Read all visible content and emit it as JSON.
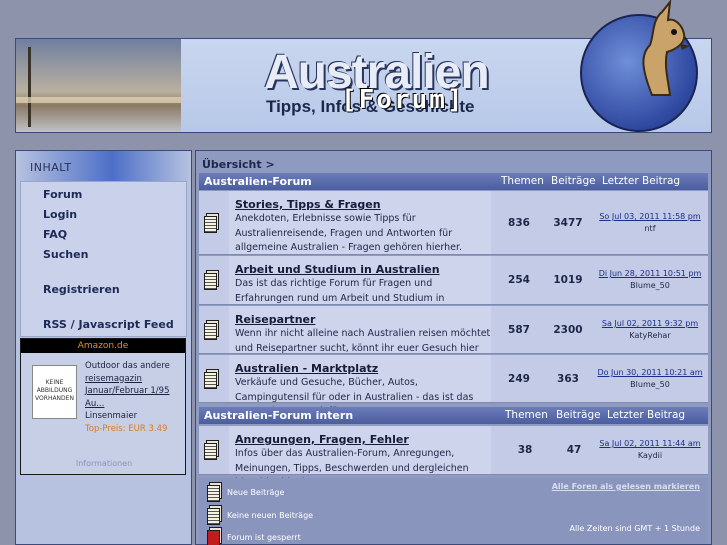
{
  "banner": {
    "title": "Australien",
    "subtitle": "Tipps, Infos & Geschichte",
    "forum_word": "[Forum]"
  },
  "sidebar": {
    "heading": "INHALT",
    "items": [
      {
        "label": "Forum"
      },
      {
        "label": "Login"
      },
      {
        "label": "FAQ"
      },
      {
        "label": "Suchen"
      },
      {
        "label": "Registrieren"
      },
      {
        "label": "RSS / Javascript Feed"
      }
    ],
    "amazon": {
      "header": "Amazon.de",
      "image_placeholder": "KEINE ABBILDUNG VORHANDEN",
      "lead": "Outdoor das andere",
      "link": "reisemagazin Januar/Februar 1/95 Au...",
      "author": "Linsenmaier",
      "price": "Top-Preis: EUR 3.49",
      "info": "Informationen"
    }
  },
  "breadcrumb": "Übersicht >",
  "categories": [
    {
      "name": "Australien-Forum",
      "col_topics": "Themen",
      "col_posts": "Beiträge",
      "col_last": "Letzter Beitrag",
      "forums": [
        {
          "title": "Stories, Tipps & Fragen",
          "desc": "Anekdoten, Erlebnisse sowie Tipps für Australienreisende, Fragen und Antworten für allgemeine Australien - Fragen gehören hierher.",
          "topics": "836",
          "posts": "3477",
          "last_date": "So Jul 03, 2011 11:58 pm",
          "last_user": "ntf"
        },
        {
          "title": "Arbeit und Studium in Australien",
          "desc": "Das ist das richtige Forum für Fragen und Erfahrungen rund um Arbeit und Studium in Australien.",
          "topics": "254",
          "posts": "1019",
          "last_date": "Di Jun 28, 2011 10:51 pm",
          "last_user": "Blume_50"
        },
        {
          "title": "Reisepartner",
          "desc": "Wenn ihr nicht alleine nach Australien reisen möchtet und Reisepartner sucht, könnt ihr euer Gesuch hier einstellen.",
          "topics": "587",
          "posts": "2300",
          "last_date": "Sa Jul 02, 2011 9:32 pm",
          "last_user": "KatyRehar"
        },
        {
          "title": "Australien - Marktplatz",
          "desc": "Verkäufe und Gesuche, Bücher, Autos, Campingutensil für oder in Australien - das ist das passende Forum dafür!",
          "topics": "249",
          "posts": "363",
          "last_date": "Do Jun 30, 2011 10:21 am",
          "last_user": "Blume_50"
        }
      ]
    },
    {
      "name": "Australien-Forum intern",
      "col_topics": "Themen",
      "col_posts": "Beiträge",
      "col_last": "Letzter Beitrag",
      "forums": [
        {
          "title": "Anregungen, Fragen, Fehler",
          "desc": "Infos über das Australien-Forum, Anregungen, Meinungen, Tipps, Beschwerden und dergleichen bitte hier hinein!",
          "topics": "38",
          "posts": "47",
          "last_date": "Sa Jul 02, 2011 11:44 am",
          "last_user": "Kaydii"
        }
      ]
    }
  ],
  "legend": {
    "new_posts": "Neue Beiträge",
    "no_new_posts": "Keine neuen Beiträge",
    "locked": "Forum ist gesperrt",
    "mark_read": "Alle Foren als gelesen markieren",
    "timezone": "Alle Zeiten sind GMT + 1 Stunde"
  }
}
